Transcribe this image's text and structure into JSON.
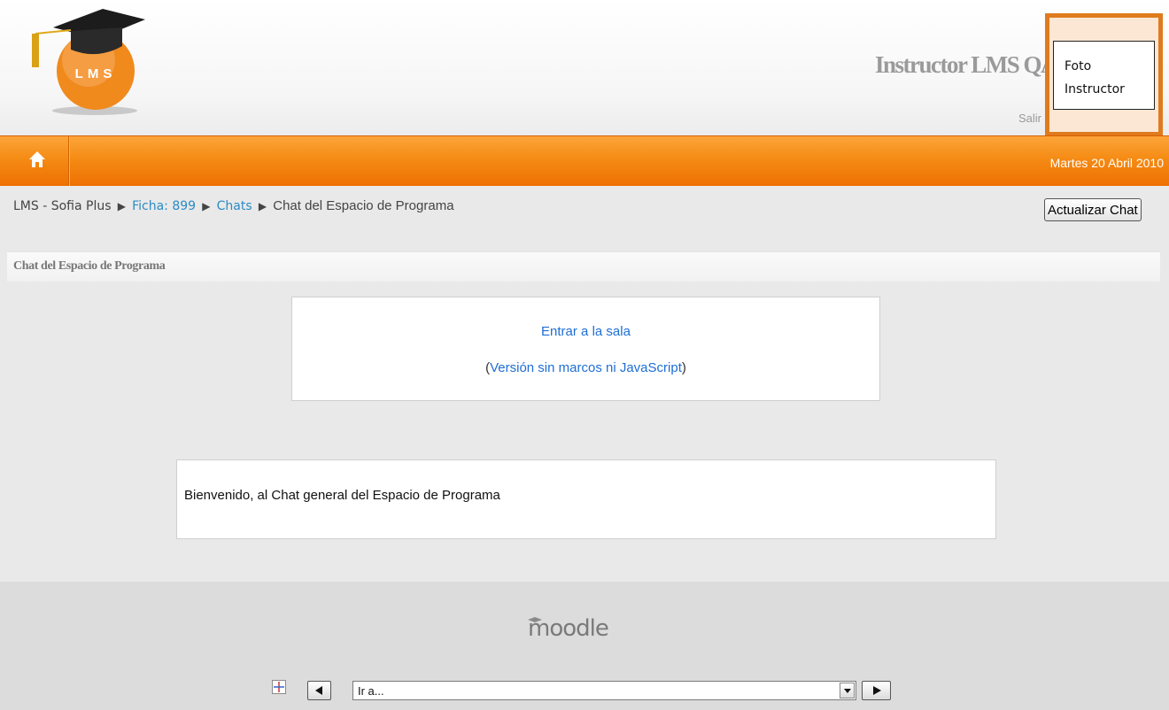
{
  "header": {
    "logo_text": "LMS",
    "site_title": "Instructor LMS QA",
    "logout": "Salir",
    "photo_line1": "Foto",
    "photo_line2": "Instructor"
  },
  "navbar": {
    "date": "Martes 20 Abril 2010",
    "accent": "#f58b14"
  },
  "breadcrumb": {
    "root": "LMS - Sofia Plus",
    "ficha": "Ficha: 899",
    "chats": "Chats",
    "current": "Chat del Espacio de Programa"
  },
  "toolbar": {
    "refresh_label": "Actualizar Chat"
  },
  "section": {
    "title": "Chat del Espacio de Programa"
  },
  "chat": {
    "enter_link": "Entrar a la sala",
    "alt_prefix": "(",
    "alt_link": "Versión sin marcos ni JavaScript",
    "alt_suffix": ")"
  },
  "welcome": {
    "message": "Bienvenido, al Chat general del Espacio de Programa"
  },
  "footer": {
    "logo_text": "moodle",
    "jump_value": "Ir a...",
    "icons": [
      "jump-to-icon",
      "prev-arrow-icon",
      "next-arrow-icon",
      "dropdown-icon"
    ]
  }
}
